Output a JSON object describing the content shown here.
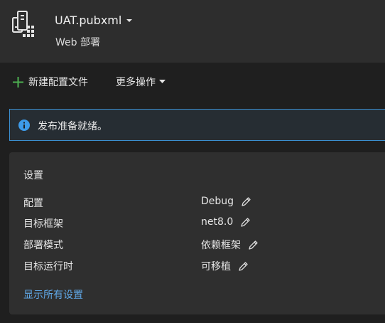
{
  "header": {
    "profile_name": "UAT.pubxml",
    "subtitle": "Web 部署",
    "icon": "publish-profile-icon"
  },
  "toolbar": {
    "new_profile_label": "新建配置文件",
    "more_actions_label": "更多操作"
  },
  "info": {
    "message": "发布准备就绪。"
  },
  "settings": {
    "title": "设置",
    "rows": [
      {
        "label": "配置",
        "value": "Debug"
      },
      {
        "label": "目标框架",
        "value": "net8.0"
      },
      {
        "label": "部署模式",
        "value": "依赖框架"
      },
      {
        "label": "目标运行时",
        "value": "可移植"
      }
    ],
    "show_all_label": "显示所有设置"
  },
  "colors": {
    "header_bg": "#2d2d2d",
    "page_bg": "#1f1f1f",
    "accent_blue": "#3b8fd0",
    "link_blue": "#5fa7e6",
    "plus_green": "#4caf50",
    "info_icon_blue": "#3d9be9"
  }
}
